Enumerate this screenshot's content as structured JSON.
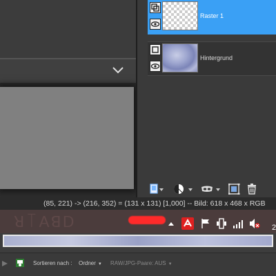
{
  "layers": [
    {
      "name": "Raster 1",
      "selected": true,
      "thumbnail": "transparent-checker"
    },
    {
      "name": "Hintergrund",
      "selected": false,
      "thumbnail": "blue-marble-texture"
    }
  ],
  "layer_toolbar": {
    "icons": [
      "new-layer-icon",
      "mask-icon",
      "blend-mode-icon",
      "layer-effects-icon",
      "merge-icon",
      "delete-icon"
    ]
  },
  "status_bar": {
    "text": "(85, 221) -> (216, 352) = (131 x 131) [1,000] -- Bild:  618 x 468 x RGB"
  },
  "taskbar": {
    "tray_text": "2",
    "tray_icons": [
      "antivirus-icon",
      "flag-icon",
      "device-icon",
      "signal-icon",
      "volume-muted-icon"
    ]
  },
  "bottom_bar": {
    "sort_label": "Sortieren nach :",
    "sort_value": "Ordner",
    "raw_jpg_label": "RAW/JPG-Paare: AUS"
  },
  "colors": {
    "selection": "#3aa0f5",
    "taskbar": "#4b3c3c",
    "panel": "#3a3a3a"
  }
}
